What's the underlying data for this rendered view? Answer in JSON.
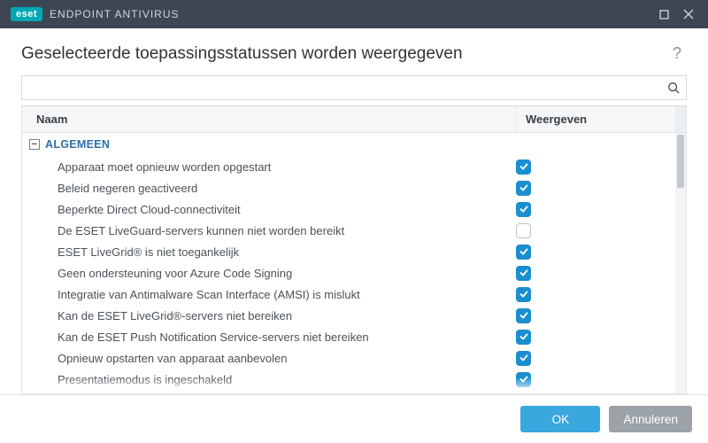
{
  "titlebar": {
    "brand": "eset",
    "product": "ENDPOINT ANTIVIRUS"
  },
  "header": {
    "title": "Geselecteerde toepassingsstatussen worden weergegeven",
    "help": "?"
  },
  "search": {
    "value": "",
    "placeholder": ""
  },
  "columns": {
    "name": "Naam",
    "show": "Weergeven"
  },
  "group": {
    "label": "ALGEMEEN",
    "collapse_glyph": "−"
  },
  "items": [
    {
      "label": "Apparaat moet opnieuw worden opgestart",
      "checked": true
    },
    {
      "label": "Beleid negeren geactiveerd",
      "checked": true
    },
    {
      "label": "Beperkte Direct Cloud-connectiviteit",
      "checked": true
    },
    {
      "label": "De ESET LiveGuard-servers kunnen niet worden bereikt",
      "checked": false
    },
    {
      "label": "ESET LiveGrid® is niet toegankelijk",
      "checked": true
    },
    {
      "label": "Geen ondersteuning voor Azure Code Signing",
      "checked": true
    },
    {
      "label": "Integratie van Antimalware Scan Interface (AMSI) is mislukt",
      "checked": true
    },
    {
      "label": "Kan de ESET LiveGrid®-servers niet bereiken",
      "checked": true
    },
    {
      "label": "Kan de ESET Push Notification Service-servers niet bereiken",
      "checked": true
    },
    {
      "label": "Opnieuw opstarten van apparaat aanbevolen",
      "checked": true
    },
    {
      "label": "Presentatiemodus is ingeschakeld",
      "checked": true
    }
  ],
  "footer": {
    "ok": "OK",
    "cancel": "Annuleren"
  }
}
